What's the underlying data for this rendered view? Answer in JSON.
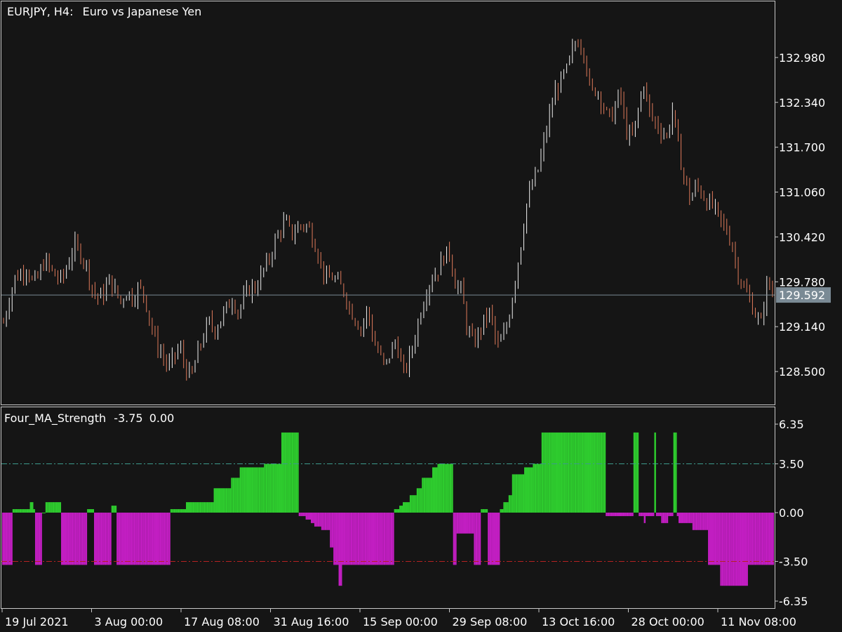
{
  "header": {
    "symbol": "EURJPY, H4:",
    "description": "Euro vs Japanese Yen"
  },
  "indicator": {
    "name": "Four_MA_Strength",
    "value1": "-3.75",
    "value2": "0.00"
  },
  "colors": {
    "background": "#151515",
    "frame": "#c8c8c8",
    "bull_candle": "#f0f0f0",
    "bear_candle": "#e07a5a",
    "positive_bar": "#2ecc2e",
    "negative_bar": "#c21ec2",
    "level_35_pos": "#3c9a8c",
    "level_35_neg": "#b52222",
    "price_line": "#7a8a95",
    "price_tag": "#7a8a95"
  },
  "current_price": "129.592",
  "chart_data": [
    {
      "type": "candlestick",
      "title": "EURJPY, H4:  Euro vs Japanese Yen",
      "y_ticks": [
        "132.980",
        "132.340",
        "131.700",
        "131.060",
        "130.420",
        "129.780",
        "129.140",
        "128.500"
      ],
      "y_tick_values": [
        132.98,
        132.34,
        131.7,
        131.06,
        130.42,
        129.78,
        129.14,
        128.5
      ],
      "ylim": [
        128.05,
        133.76
      ],
      "current_price": 129.592,
      "close_series": [
        129.2,
        129.55,
        129.85,
        129.9,
        130.0,
        129.75,
        129.85,
        130.1,
        129.95,
        129.85,
        129.8,
        130.05,
        130.3,
        130.2,
        130.05,
        129.7,
        129.55,
        129.6,
        129.8,
        129.65,
        129.5,
        129.65,
        129.55,
        129.7,
        129.6,
        129.2,
        128.9,
        128.75,
        128.55,
        128.7,
        128.85,
        128.55,
        128.4,
        128.75,
        129.0,
        129.2,
        129.1,
        129.25,
        129.4,
        129.55,
        129.35,
        129.55,
        129.7,
        129.7,
        129.9,
        130.05,
        130.3,
        130.5,
        130.65,
        130.45,
        130.55,
        130.6,
        130.55,
        130.35,
        130.05,
        129.8,
        129.85,
        129.75,
        129.65,
        129.4,
        129.25,
        129.1,
        129.4,
        128.95,
        128.75,
        128.55,
        128.8,
        128.95,
        128.45,
        128.65,
        128.95,
        129.35,
        129.65,
        129.85,
        129.95,
        130.15,
        130.2,
        129.75,
        129.65,
        129.1,
        128.9,
        129.05,
        129.25,
        129.35,
        128.85,
        128.95,
        129.25,
        129.75,
        130.25,
        130.85,
        131.15,
        131.35,
        131.75,
        132.15,
        132.5,
        132.65,
        132.8,
        133.1,
        133.25,
        133.05,
        132.45,
        132.55,
        132.35,
        132.1,
        132.2,
        132.5,
        131.95,
        131.8,
        132.15,
        132.65,
        132.2,
        132.05,
        131.95,
        131.85,
        132.25,
        131.65,
        131.25,
        130.95,
        131.15,
        131.05,
        130.9,
        130.85,
        130.65,
        130.55,
        130.35,
        129.95,
        129.7,
        129.55,
        129.35,
        129.15,
        129.75,
        129.65
      ]
    },
    {
      "type": "bar",
      "title": "Four_MA_Strength -3.75 0.00",
      "y_ticks": [
        "6.35",
        "3.50",
        "0.00",
        "-3.50",
        "-6.35"
      ],
      "y_tick_values": [
        6.35,
        3.5,
        0.0,
        -3.5,
        -6.35
      ],
      "ylim": [
        -6.35,
        6.35
      ],
      "levels": [
        3.5,
        -3.5
      ],
      "series_segments": [
        {
          "count": 6,
          "value": -3.75
        },
        {
          "count": 10,
          "value": 0.25
        },
        {
          "count": 2,
          "value": 0.75
        },
        {
          "count": 1,
          "value": 0.25
        },
        {
          "count": 4,
          "value": -3.75
        },
        {
          "count": 2,
          "value": 0.0
        },
        {
          "count": 9,
          "value": 0.75
        },
        {
          "count": 15,
          "value": -3.75
        },
        {
          "count": 4,
          "value": 0.25
        },
        {
          "count": 10,
          "value": -3.75
        },
        {
          "count": 3,
          "value": 0.5
        },
        {
          "count": 31,
          "value": -3.75
        },
        {
          "count": 9,
          "value": 0.25
        },
        {
          "count": 16,
          "value": 0.75
        },
        {
          "count": 5,
          "value": 1.75
        },
        {
          "count": 5,
          "value": 1.75
        },
        {
          "count": 5,
          "value": 2.5
        },
        {
          "count": 14,
          "value": 3.25
        },
        {
          "count": 10,
          "value": 3.5
        },
        {
          "count": 10,
          "value": 5.75
        },
        {
          "count": 4,
          "value": -0.25
        },
        {
          "count": 3,
          "value": -0.5
        },
        {
          "count": 2,
          "value": -0.75
        },
        {
          "count": 4,
          "value": -1.0
        },
        {
          "count": 5,
          "value": -1.25
        },
        {
          "count": 2,
          "value": -2.5
        },
        {
          "count": 3,
          "value": -3.75
        },
        {
          "count": 2,
          "value": -5.25
        },
        {
          "count": 30,
          "value": -3.75
        },
        {
          "count": 3,
          "value": 0.25
        },
        {
          "count": 2,
          "value": 0.5
        },
        {
          "count": 4,
          "value": 0.75
        },
        {
          "count": 4,
          "value": 1.25
        },
        {
          "count": 3,
          "value": 1.75
        },
        {
          "count": 6,
          "value": 2.5
        },
        {
          "count": 3,
          "value": 3.25
        },
        {
          "count": 9,
          "value": 3.5
        },
        {
          "count": 2,
          "value": -3.75
        },
        {
          "count": 10,
          "value": -1.5
        },
        {
          "count": 4,
          "value": -3.75
        },
        {
          "count": 4,
          "value": 0.25
        },
        {
          "count": 7,
          "value": -3.75
        },
        {
          "count": 2,
          "value": 0.25
        },
        {
          "count": 3,
          "value": 0.75
        },
        {
          "count": 2,
          "value": 1.25
        },
        {
          "count": 7,
          "value": 2.75
        },
        {
          "count": 5,
          "value": 3.25
        },
        {
          "count": 5,
          "value": 3.5
        },
        {
          "count": 37,
          "value": 5.75
        },
        {
          "count": 11,
          "value": -0.25
        },
        {
          "count": 5,
          "value": -0.25
        },
        {
          "count": 3,
          "value": 5.75
        },
        {
          "count": 3,
          "value": -0.25
        },
        {
          "count": 1,
          "value": -0.75
        },
        {
          "count": 5,
          "value": -0.25
        },
        {
          "count": 1,
          "value": 5.75
        },
        {
          "count": 3,
          "value": -0.25
        },
        {
          "count": 4,
          "value": -0.75
        },
        {
          "count": 3,
          "value": -0.25
        },
        {
          "count": 2,
          "value": 5.75
        },
        {
          "count": 1,
          "value": -0.25
        },
        {
          "count": 8,
          "value": -0.75
        },
        {
          "count": 9,
          "value": -1.25
        },
        {
          "count": 7,
          "value": -3.75
        },
        {
          "count": 16,
          "value": -5.25
        },
        {
          "count": 15,
          "value": -3.75
        }
      ]
    }
  ],
  "x_axis": {
    "labels": [
      "19 Jul 2021",
      "3 Aug 00:00",
      "17 Aug 08:00",
      "31 Aug 16:00",
      "15 Sep 00:00",
      "29 Sep 08:00",
      "13 Oct 16:00",
      "28 Oct 00:00",
      "11 Nov 08:00"
    ]
  }
}
